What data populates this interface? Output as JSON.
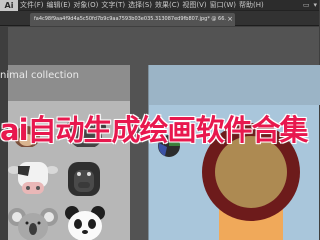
{
  "menubar": {
    "app_icon": "Ai",
    "items": [
      "文件(F)",
      "编辑(E)",
      "对象(O)",
      "文字(T)",
      "选择(S)",
      "效果(C)",
      "视图(V)",
      "窗口(W)",
      "帮助(H)"
    ],
    "right": [
      "▭",
      "▾"
    ]
  },
  "tab": {
    "title": "fa4c98f9aa4f9d4a5c50fd7b9c9aa7593b03e035.313087ed9fb807.jpg* @ 66.67% (RGB/预览)",
    "close": "×"
  },
  "artboard_left": {
    "title": "nimal collection"
  },
  "overlay": {
    "caption": "ai自动生成绘画软件合集"
  },
  "colors": {
    "caption": "#e8184e",
    "right_artboard": "#a9c6db",
    "ring": "#6d1b1b",
    "ring_fill": "#ad8a52",
    "orange_rect": "#f0a95a"
  }
}
